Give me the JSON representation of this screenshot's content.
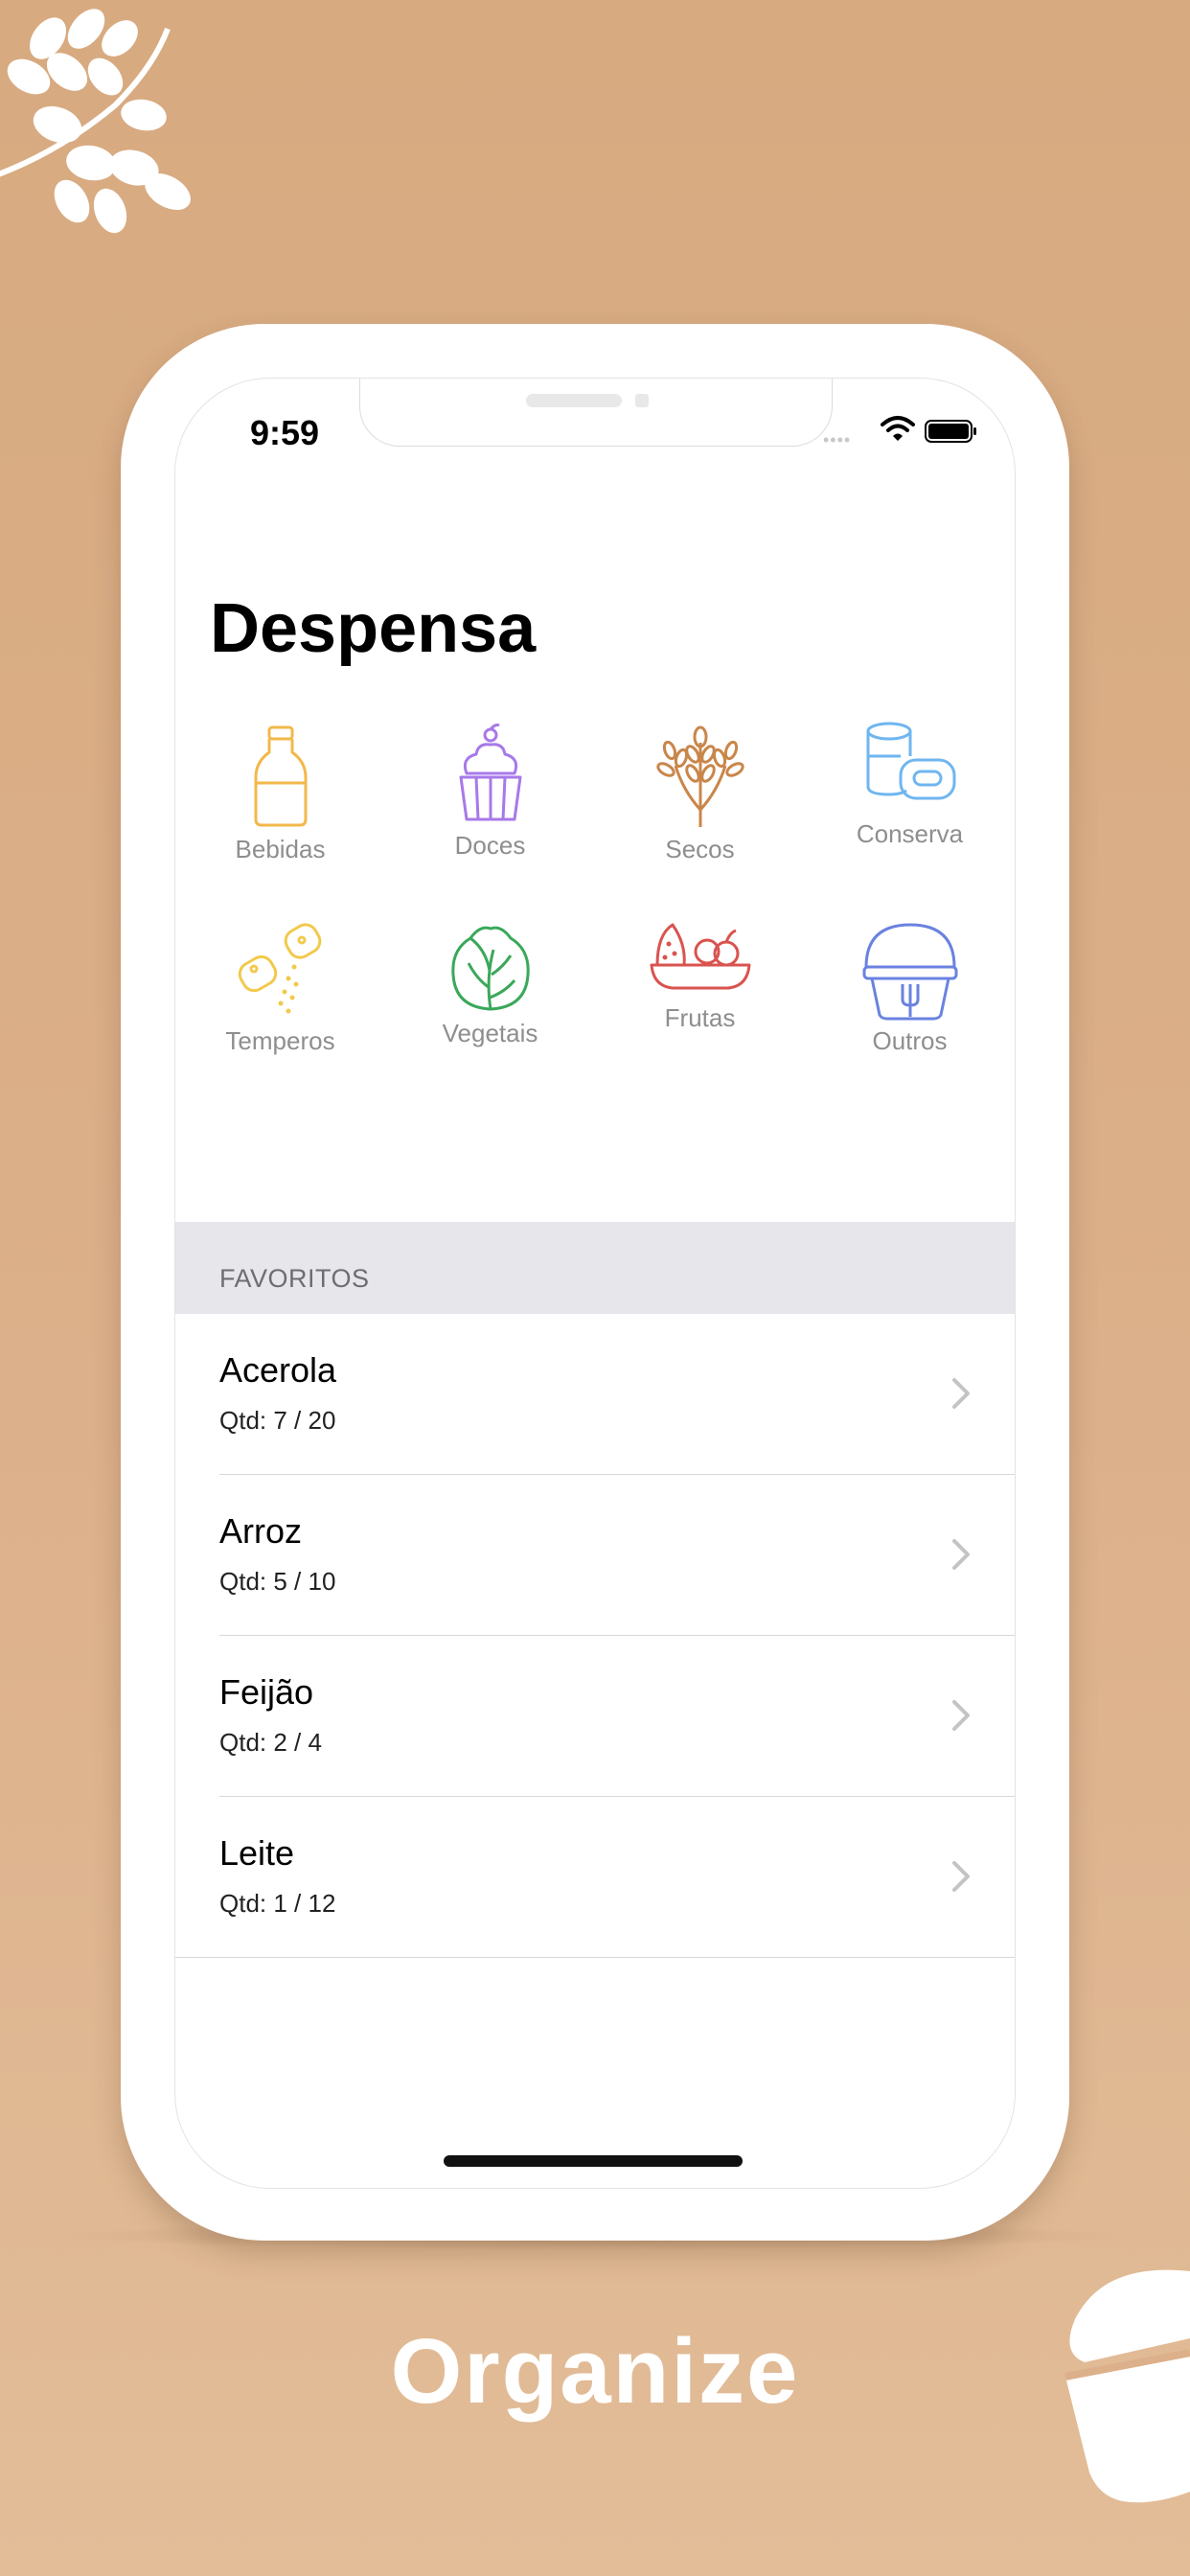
{
  "status_bar": {
    "time": "9:59"
  },
  "screen": {
    "title": "Despensa"
  },
  "categories": [
    {
      "label": "Bebidas",
      "icon": "milk-bottle-icon"
    },
    {
      "label": "Doces",
      "icon": "cupcake-icon"
    },
    {
      "label": "Secos",
      "icon": "wheat-icon"
    },
    {
      "label": "Conserva",
      "icon": "cans-icon"
    },
    {
      "label": "Temperos",
      "icon": "salt-pepper-icon"
    },
    {
      "label": "Vegetais",
      "icon": "lettuce-icon"
    },
    {
      "label": "Frutas",
      "icon": "fruit-bowl-icon"
    },
    {
      "label": "Outros",
      "icon": "lunchbox-icon"
    }
  ],
  "favorites": {
    "header": "FAVORITOS",
    "items": [
      {
        "name": "Acerola",
        "qty": "Qtd: 7 / 20"
      },
      {
        "name": "Arroz",
        "qty": "Qtd: 5 / 10"
      },
      {
        "name": "Feijão",
        "qty": "Qtd: 2 / 4"
      },
      {
        "name": "Leite",
        "qty": "Qtd: 1 / 12"
      }
    ]
  },
  "caption": "Organize",
  "colors": {
    "background": "#d9ad86",
    "bebidas": "#f2b84b",
    "doces": "#a779e9",
    "secos": "#c9864a",
    "conserva": "#6fb6f0",
    "temperos": "#f2c94c",
    "vegetais": "#3aa85a",
    "frutas": "#d9534f",
    "outros": "#6a82e0"
  }
}
